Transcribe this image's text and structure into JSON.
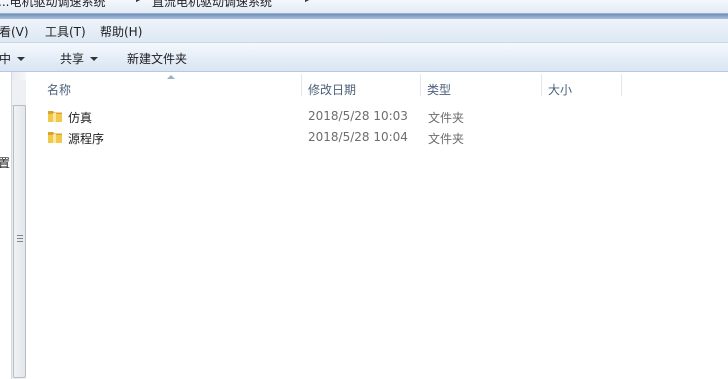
{
  "address_bar": {
    "crumbs": [
      "...电机驱动调速系统",
      "直流电机驱动调速系统"
    ],
    "separator": "▶"
  },
  "menu": {
    "items": [
      "看(V)",
      "工具(T)",
      "帮助(H)"
    ]
  },
  "command_bar": {
    "items": [
      "中",
      "共享",
      "新建文件夹"
    ]
  },
  "nav_pane": {
    "truncated_label": "置"
  },
  "columns": {
    "name": "名称",
    "date_modified": "修改日期",
    "type": "类型",
    "size": "大小"
  },
  "files": [
    {
      "name": "仿真",
      "date_modified": "2018/5/28 10:03",
      "type": "文件夹",
      "size": ""
    },
    {
      "name": "源程序",
      "date_modified": "2018/5/28 10:04",
      "type": "文件夹",
      "size": ""
    }
  ],
  "colors": {
    "header_text": "#4c607a",
    "secondary_text": "#6d6d6d",
    "folder": "#e8b93c"
  }
}
